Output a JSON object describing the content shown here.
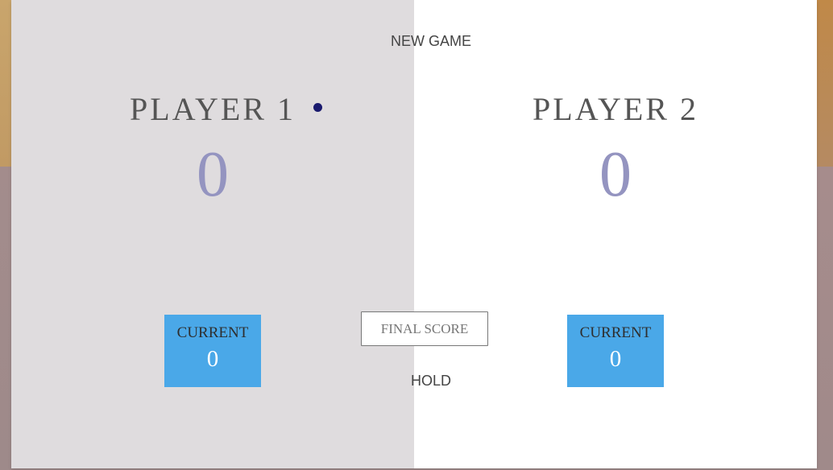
{
  "game": {
    "new_game_label": "NEW GAME",
    "hold_label": "HOLD",
    "final_score_placeholder": "FINAL SCORE",
    "active_player": 1,
    "colors": {
      "panel_active": "#dfdcde",
      "panel_inactive": "#ffffff",
      "current_box": "#4aa8e8",
      "score": "#9494c0",
      "active_dot": "#1a1a6e"
    }
  },
  "players": [
    {
      "name": "PLAYER 1",
      "score": "0",
      "current_label": "CURRENT",
      "current_score": "0"
    },
    {
      "name": "PLAYER 2",
      "score": "0",
      "current_label": "CURRENT",
      "current_score": "0"
    }
  ]
}
